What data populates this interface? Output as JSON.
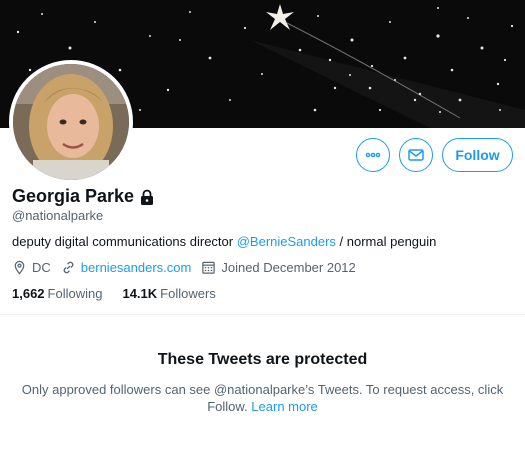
{
  "profile": {
    "name": "Georgia Parke",
    "handle": "@nationalparke",
    "bio_prefix": "deputy digital communications director ",
    "bio_mention": "@BernieSanders",
    "bio_suffix": " / normal penguin",
    "location": "DC",
    "website": "berniesanders.com",
    "joined": "Joined December 2012",
    "following_count": "1,662",
    "following_label": "Following",
    "followers_count": "14.1K",
    "followers_label": "Followers"
  },
  "actions": {
    "follow_label": "Follow",
    "more_icon": "more-icon",
    "message_icon": "envelope-icon"
  },
  "protected": {
    "title": "These Tweets are protected",
    "body": "Only approved followers can see @nationalparke’s Tweets. To request access, click Follow.",
    "learn_more": "Learn more"
  },
  "colors": {
    "accent": "#1d9bf0",
    "text": "#0f1419",
    "secondary": "#536471"
  }
}
